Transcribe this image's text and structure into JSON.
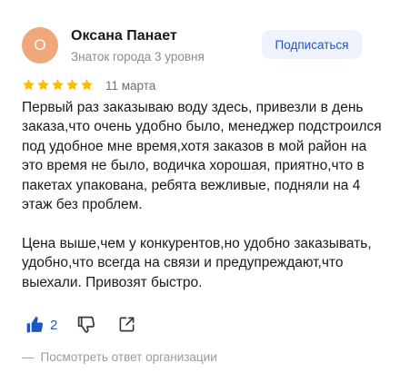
{
  "author": {
    "initial": "О",
    "name": "Оксана Панает",
    "level": "Знаток города 3 уровня",
    "avatar_color": "#f0a77b"
  },
  "subscribe": {
    "label": "Подписаться",
    "color": "#1e56c7"
  },
  "review": {
    "rating": 5,
    "rating_max": 5,
    "star_color": "#fbbc05",
    "date": "11 марта",
    "paragraphs": [
      "Первый раз заказываю воду здесь, привезли в день заказа,что очень удобно было, менеджер подстроился под удобное мне время,хотя заказов в мой район на это время не было, водичка хорошая, приятно,что в пакетах упакована, ребята вежливые, подняли на 4 этаж без проблем.",
      "Цена выше,чем у конкурентов,но удобно заказывать, удобно,что всегда на связи и предупреждают,что выехали. Привозят быстро."
    ]
  },
  "actions": {
    "like_count": "2",
    "like_icon": "thumbs-up-icon",
    "dislike_icon": "thumbs-down-icon",
    "share_icon": "share-icon"
  },
  "org_reply": {
    "dash": "—",
    "label": "Посмотреть ответ организации"
  }
}
